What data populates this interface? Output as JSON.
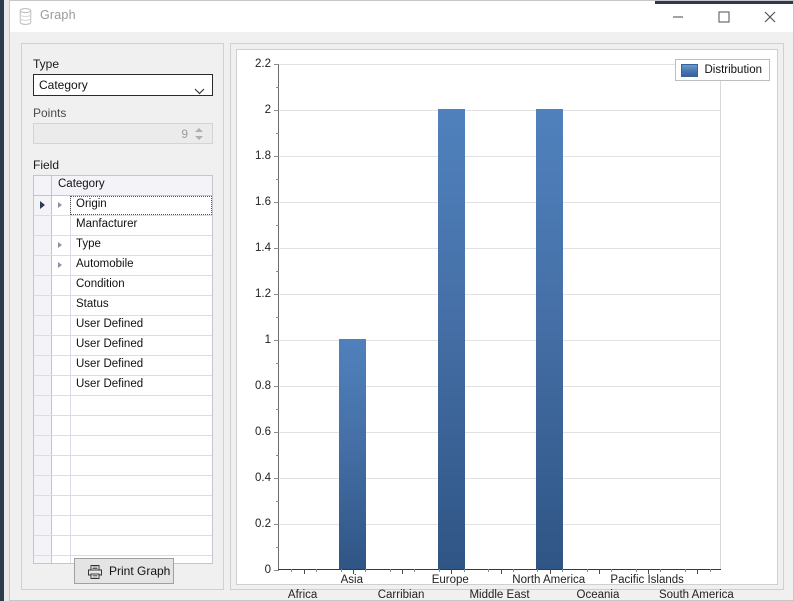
{
  "window": {
    "title": "Graph",
    "icon": "database-stack-icon",
    "buttons": {
      "minimize": "minimize-icon",
      "maximize": "maximize-icon",
      "close": "close-icon"
    }
  },
  "left_panel": {
    "type_label": "Type",
    "type_value": "Category",
    "points_label": "Points",
    "points_value": "9",
    "field_label": "Field",
    "grid_header": "Category",
    "rows": [
      {
        "label": "Origin",
        "expandable": true,
        "selected": true
      },
      {
        "label": "Manfacturer",
        "expandable": false,
        "selected": false
      },
      {
        "label": "Type",
        "expandable": true,
        "selected": false
      },
      {
        "label": "Automobile",
        "expandable": true,
        "selected": false
      },
      {
        "label": "Condition",
        "expandable": false,
        "selected": false
      },
      {
        "label": "Status",
        "expandable": false,
        "selected": false
      },
      {
        "label": "User Defined",
        "expandable": false,
        "selected": false
      },
      {
        "label": "User Defined",
        "expandable": false,
        "selected": false
      },
      {
        "label": "User Defined",
        "expandable": false,
        "selected": false
      },
      {
        "label": "User Defined",
        "expandable": false,
        "selected": false
      }
    ],
    "print_button": "Print Graph",
    "print_icon": "printer-icon"
  },
  "chart_data": {
    "type": "bar",
    "title": "",
    "xlabel": "",
    "ylabel": "",
    "categories": [
      "Africa",
      "Asia",
      "Carribian",
      "Europe",
      "Middle East",
      "North America",
      "Oceania",
      "Pacific Islands",
      "South America"
    ],
    "values": [
      0,
      1,
      0,
      2,
      0,
      2,
      0,
      0,
      0
    ],
    "series": [
      {
        "name": "Distribution",
        "values": [
          0,
          1,
          0,
          2,
          0,
          2,
          0,
          0,
          0
        ]
      }
    ],
    "ylim": [
      0,
      2.2
    ],
    "ytick_labels": [
      "0",
      "0.2",
      "0.4",
      "0.6",
      "0.8",
      "1",
      "1.2",
      "1.4",
      "1.6",
      "1.8",
      "2",
      "2.2"
    ],
    "ytick_values": [
      0,
      0.2,
      0.4,
      0.6,
      0.8,
      1,
      1.2,
      1.4,
      1.6,
      1.8,
      2,
      2.2
    ],
    "grid": true,
    "legend": [
      "Distribution"
    ],
    "legend_position": "top-right",
    "bar_color": "#4a7ab4",
    "bar_color_top": "#5081bd",
    "bar_color_bottom": "#2f5585",
    "axis_color": "#2b3a4d"
  }
}
